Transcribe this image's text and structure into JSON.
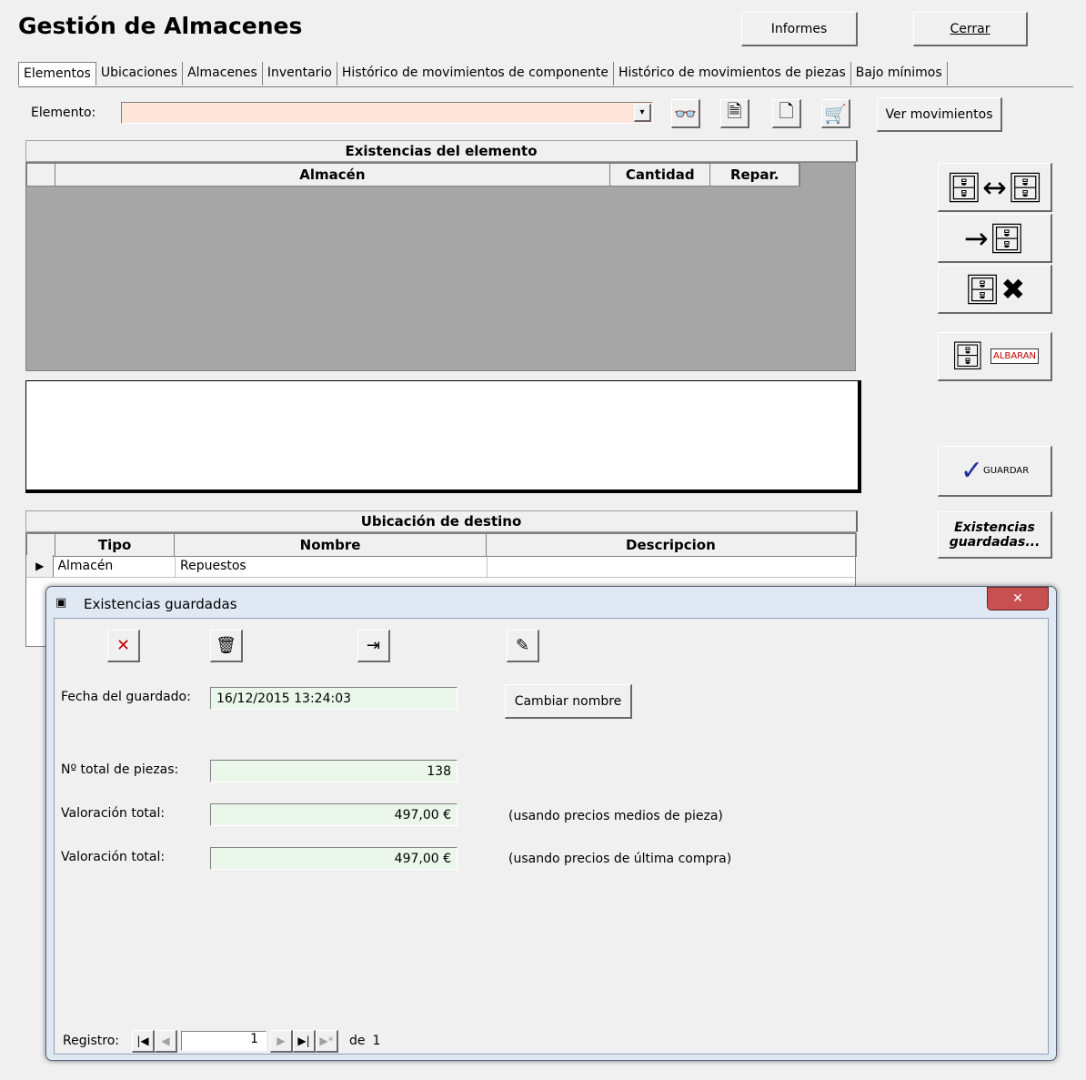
{
  "window": {
    "title": "Gestión de Almacenes"
  },
  "toolbar": {
    "informes": "Informes",
    "cerrar": "Cerrar"
  },
  "tabs": [
    {
      "label": "Elementos"
    },
    {
      "label": "Ubicaciones"
    },
    {
      "label": "Almacenes"
    },
    {
      "label": "Inventario"
    },
    {
      "label": "Histórico de movimientos de componente"
    },
    {
      "label": "Histórico de movimientos de piezas"
    },
    {
      "label": "Bajo mínimos"
    }
  ],
  "elemento": {
    "label": "Elemento:",
    "value": "",
    "ver_movimientos": "Ver movimientos"
  },
  "existencias": {
    "title": "Existencias del elemento",
    "columns": [
      "Almacén",
      "Cantidad",
      "Repar."
    ]
  },
  "destino": {
    "title": "Ubicación de destino",
    "columns": [
      "Tipo",
      "Nombre",
      "Descripcion"
    ],
    "rows": [
      {
        "tipo": "Almacén",
        "nombre": "Repuestos",
        "descripcion": ""
      }
    ]
  },
  "side": {
    "guardar": "GUARDAR",
    "existencias_guardadas": "Existencias guardadas...",
    "albaran": "ALBARAN"
  },
  "dialog": {
    "title": "Existencias guardadas",
    "fecha_label": "Fecha del guardado:",
    "fecha_value": "16/12/2015 13:24:03",
    "cambiar_nombre": "Cambiar nombre",
    "total_piezas_label": "Nº total de piezas:",
    "total_piezas_value": "138",
    "valoracion1_label": "Valoración total:",
    "valoracion1_value": "497,00 €",
    "valoracion1_note": "(usando precios medios de pieza)",
    "valoracion2_label": "Valoración total:",
    "valoracion2_value": "497,00 €",
    "valoracion2_note": "(usando precios de última compra)",
    "registro_label": "Registro:",
    "registro_value": "1",
    "registro_de": "de",
    "registro_total": "1"
  }
}
